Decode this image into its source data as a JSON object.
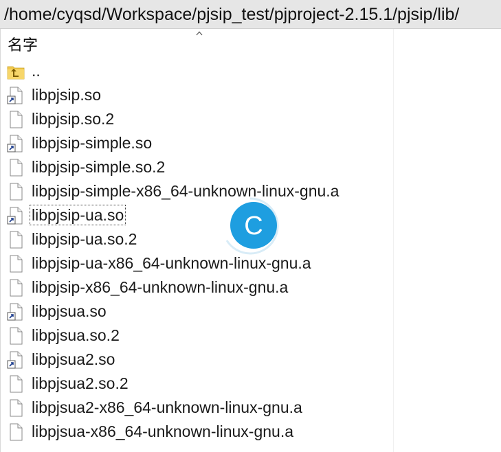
{
  "path_bar": {
    "path": "/home/cyqsd/Workspace/pjsip_test/pjproject-2.15.1/pjsip/lib/"
  },
  "header": {
    "name_column": "名字",
    "sort_icon": "chevron-up-icon"
  },
  "files": [
    {
      "name": "..",
      "icon": "parent-folder-icon",
      "type": "parent"
    },
    {
      "name": "libpjsip.so",
      "icon": "symlink-file-icon",
      "type": "link"
    },
    {
      "name": "libpjsip.so.2",
      "icon": "file-icon",
      "type": "file"
    },
    {
      "name": "libpjsip-simple.so",
      "icon": "symlink-file-icon",
      "type": "link"
    },
    {
      "name": "libpjsip-simple.so.2",
      "icon": "file-icon",
      "type": "file"
    },
    {
      "name": "libpjsip-simple-x86_64-unknown-linux-gnu.a",
      "icon": "file-icon",
      "type": "file"
    },
    {
      "name": "libpjsip-ua.so",
      "icon": "symlink-file-icon",
      "type": "link",
      "focused": true
    },
    {
      "name": "libpjsip-ua.so.2",
      "icon": "file-icon",
      "type": "file"
    },
    {
      "name": "libpjsip-ua-x86_64-unknown-linux-gnu.a",
      "icon": "file-icon",
      "type": "file"
    },
    {
      "name": "libpjsip-x86_64-unknown-linux-gnu.a",
      "icon": "file-icon",
      "type": "file"
    },
    {
      "name": "libpjsua.so",
      "icon": "symlink-file-icon",
      "type": "link"
    },
    {
      "name": "libpjsua.so.2",
      "icon": "file-icon",
      "type": "file"
    },
    {
      "name": "libpjsua2.so",
      "icon": "symlink-file-icon",
      "type": "link"
    },
    {
      "name": "libpjsua2.so.2",
      "icon": "file-icon",
      "type": "file"
    },
    {
      "name": "libpjsua2-x86_64-unknown-linux-gnu.a",
      "icon": "file-icon",
      "type": "file"
    },
    {
      "name": "libpjsua-x86_64-unknown-linux-gnu.a",
      "icon": "file-icon",
      "type": "file"
    }
  ],
  "overlay": {
    "icon": "loading-spinner-icon",
    "letter": "C",
    "color": "#1e9ee0"
  }
}
